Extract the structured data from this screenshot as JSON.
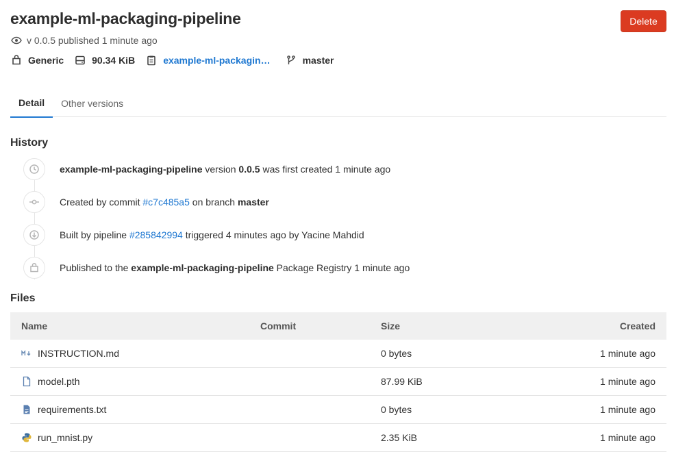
{
  "package": {
    "title": "example-ml-packaging-pipeline",
    "version_line": "v 0.0.5 published 1 minute ago",
    "type": "Generic",
    "size": "90.34 KiB",
    "project": "example-ml-packagin…",
    "branch": "master"
  },
  "actions": {
    "delete_label": "Delete"
  },
  "tabs": [
    {
      "label": "Detail",
      "active": true
    },
    {
      "label": "Other versions",
      "active": false
    }
  ],
  "history": {
    "heading": "History",
    "entries": [
      {
        "icon": "clock-icon",
        "name": "example-ml-packaging-pipeline",
        "t1": " version ",
        "version": "0.0.5",
        "t2": " was first created 1 minute ago"
      },
      {
        "icon": "commit-icon",
        "t1": "Created by commit ",
        "commit": "#c7c485a5",
        "t2": " on branch ",
        "branch": "master"
      },
      {
        "icon": "pipeline-icon",
        "t1": "Built by pipeline ",
        "pipeline": "#285842994",
        "t2": " triggered 4 minutes ago by Yacine Mahdid"
      },
      {
        "icon": "package-icon",
        "t1": "Published to the ",
        "name": "example-ml-packaging-pipeline",
        "t2": " Package Registry 1 minute ago"
      }
    ]
  },
  "files": {
    "heading": "Files",
    "columns": {
      "name": "Name",
      "commit": "Commit",
      "size": "Size",
      "created": "Created"
    },
    "rows": [
      {
        "icon": "markdown-icon",
        "name": "INSTRUCTION.md",
        "commit": "",
        "size": "0 bytes",
        "created": "1 minute ago"
      },
      {
        "icon": "file-icon",
        "name": "model.pth",
        "commit": "",
        "size": "87.99 KiB",
        "created": "1 minute ago"
      },
      {
        "icon": "text-file-icon",
        "name": "requirements.txt",
        "commit": "",
        "size": "0 bytes",
        "created": "1 minute ago"
      },
      {
        "icon": "python-icon",
        "name": "run_mnist.py",
        "commit": "",
        "size": "2.35 KiB",
        "created": "1 minute ago"
      }
    ]
  },
  "colors": {
    "accent": "#1f78d1",
    "danger": "#db3b21",
    "header_bg": "#f0f0f0"
  }
}
